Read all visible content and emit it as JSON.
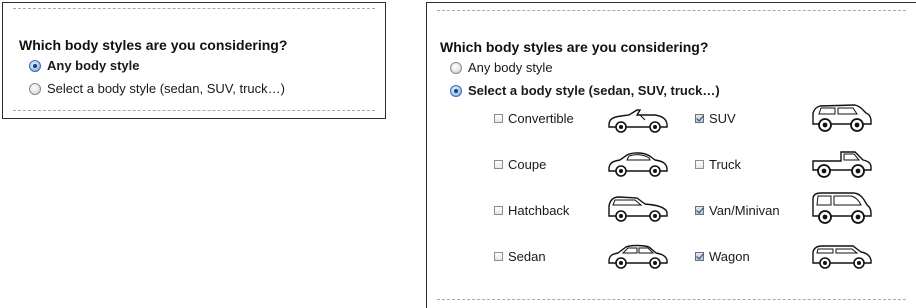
{
  "question": "Which body styles are you considering?",
  "radio_options": [
    {
      "id": "any",
      "label": "Any body style"
    },
    {
      "id": "select",
      "label": "Select a body style (sedan, SUV, truck…)"
    }
  ],
  "left_panel": {
    "selected_radio": "any"
  },
  "right_panel": {
    "selected_radio": "select",
    "body_styles": [
      {
        "label": "Convertible",
        "checked": false,
        "icon": "convertible-icon"
      },
      {
        "label": "SUV",
        "checked": true,
        "icon": "suv-icon"
      },
      {
        "label": "Coupe",
        "checked": false,
        "icon": "coupe-icon"
      },
      {
        "label": "Truck",
        "checked": false,
        "icon": "truck-icon"
      },
      {
        "label": "Hatchback",
        "checked": false,
        "icon": "hatchback-icon"
      },
      {
        "label": "Van/Minivan",
        "checked": true,
        "icon": "van-icon"
      },
      {
        "label": "Sedan",
        "checked": false,
        "icon": "sedan-icon"
      },
      {
        "label": "Wagon",
        "checked": true,
        "icon": "wagon-icon"
      }
    ]
  },
  "colors": {
    "radio_selected": "#5d8fd3",
    "border": "#2b2b2b",
    "divider": "#a9a9a9"
  }
}
